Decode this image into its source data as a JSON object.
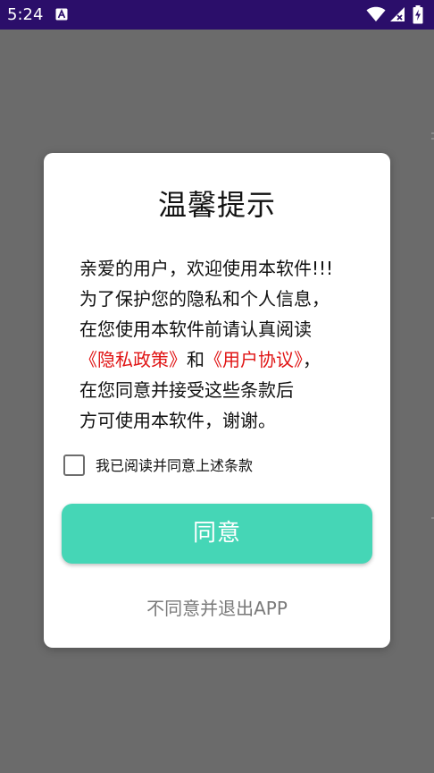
{
  "status_bar": {
    "time": "5:24",
    "notification_icon": "a-notification-icon",
    "wifi_icon": "wifi-icon",
    "signal_icon": "signal-off-icon",
    "battery_icon": "battery-charging-icon",
    "background_color": "#2b0e6a"
  },
  "dialog": {
    "title": "温馨提示",
    "body_lines": {
      "l1": "亲爱的用户，欢迎使用本软件!!!",
      "l2": "为了保护您的隐私和个人信息，",
      "l3": "在您使用本软件前请认真阅读",
      "l4_link1": "《隐私政策》",
      "l4_mid": "和",
      "l4_link2": "《用户协议》",
      "l4_end": "，",
      "l5": "在您同意并接受这些条款后",
      "l6": "方可使用本软件，谢谢。"
    },
    "checkbox_label": "我已阅读并同意上述条款",
    "checkbox_checked": false,
    "agree_button": "同意",
    "exit_link": "不同意并退出APP"
  },
  "colors": {
    "accent": "#45d6b6",
    "link": "#e01414",
    "scrim": "#6b6b6b"
  }
}
